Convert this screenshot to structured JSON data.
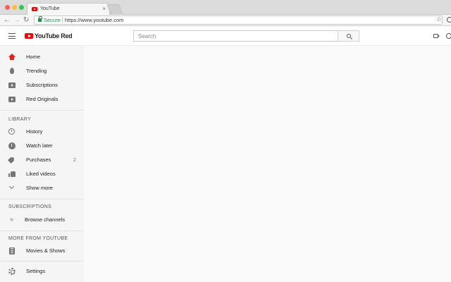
{
  "browser": {
    "tab_title": "YouTube",
    "tab_close": "×",
    "secure_label": "Secure",
    "url": "https://www.youtube.com",
    "nav": {
      "back": "←",
      "forward": "→",
      "reload": "↻",
      "star": "☆"
    }
  },
  "header": {
    "logo_text": "YouTube Red",
    "search_placeholder": "Search"
  },
  "sidebar": {
    "main_items": [
      {
        "label": "Home",
        "icon": "home-icon",
        "active": true
      },
      {
        "label": "Trending",
        "icon": "trending-icon"
      },
      {
        "label": "Subscriptions",
        "icon": "subscriptions-icon"
      },
      {
        "label": "Red Originals",
        "icon": "red-originals-icon"
      }
    ],
    "library_title": "LIBRARY",
    "library_items": [
      {
        "label": "History",
        "icon": "history-icon"
      },
      {
        "label": "Watch later",
        "icon": "watch-later-icon"
      },
      {
        "label": "Purchases",
        "icon": "purchases-icon",
        "count": "2"
      },
      {
        "label": "Liked videos",
        "icon": "liked-videos-icon"
      },
      {
        "label": "Show more",
        "icon": "chevron-down-icon"
      }
    ],
    "subscriptions_title": "SUBSCRIPTIONS",
    "subscriptions_items": [
      {
        "label": "Browse channels",
        "icon": "browse-channels-icon"
      }
    ],
    "more_title": "MORE FROM YOUTUBE",
    "more_items": [
      {
        "label": "Movies & Shows",
        "icon": "movies-icon"
      }
    ],
    "settings_label": "Settings"
  },
  "colors": {
    "accent": "#e62117",
    "secure": "#1e8e3e",
    "sidebar_bg": "#f5f5f5",
    "main_bg": "#fafafa"
  }
}
